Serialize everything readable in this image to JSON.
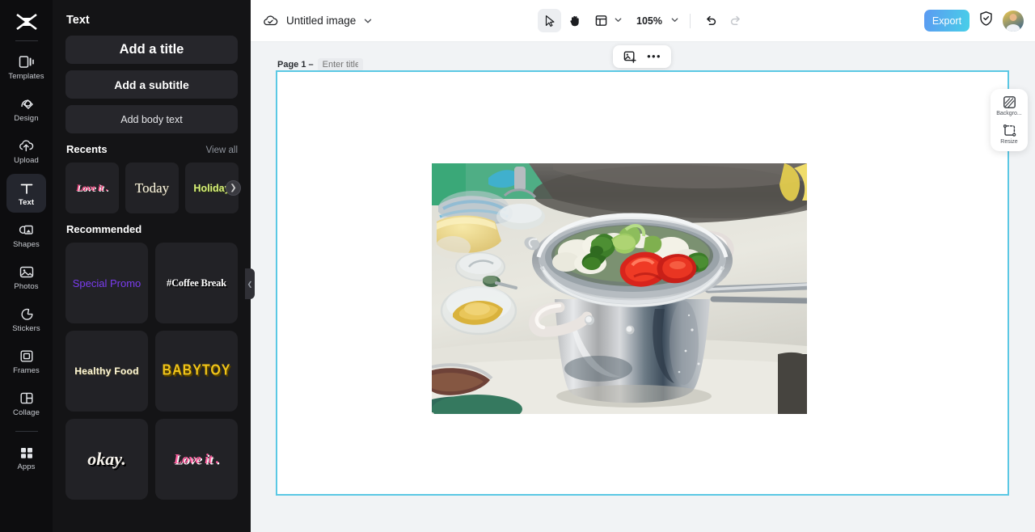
{
  "rail": {
    "logo_icon": "capcut-logo-icon",
    "items": [
      {
        "label": "Templates",
        "icon": "templates-icon",
        "active": false
      },
      {
        "label": "Design",
        "icon": "design-icon",
        "active": false
      },
      {
        "label": "Upload",
        "icon": "upload-cloud-icon",
        "active": false
      },
      {
        "label": "Text",
        "icon": "text-icon",
        "active": true
      },
      {
        "label": "Shapes",
        "icon": "shapes-icon",
        "active": false
      },
      {
        "label": "Photos",
        "icon": "photos-icon",
        "active": false
      },
      {
        "label": "Stickers",
        "icon": "stickers-icon",
        "active": false
      },
      {
        "label": "Frames",
        "icon": "frames-icon",
        "active": false
      },
      {
        "label": "Collage",
        "icon": "collage-icon",
        "active": false
      },
      {
        "label": "Apps",
        "icon": "apps-grid-icon",
        "active": false
      }
    ]
  },
  "panel": {
    "title": "Text",
    "add_buttons": [
      {
        "label": "Add a title"
      },
      {
        "label": "Add a subtitle"
      },
      {
        "label": "Add body text"
      }
    ],
    "recents": {
      "title": "Recents",
      "view_all": "View all",
      "next_icon": "chevron-right-icon",
      "items": [
        {
          "label": "Love it ."
        },
        {
          "label": "Today"
        },
        {
          "label": "Holiday"
        }
      ]
    },
    "recommended": {
      "title": "Recommended",
      "items": [
        {
          "label": "Special Promo"
        },
        {
          "label": "#Coffee Break"
        },
        {
          "label": "Healthy Food"
        },
        {
          "label": "BABYTOY"
        },
        {
          "label": "okay."
        },
        {
          "label": "Love it ."
        }
      ]
    },
    "collapse_icon": "chevron-left-icon"
  },
  "topbar": {
    "cloud_icon": "cloud-saved-icon",
    "doc_title": "Untitled image",
    "title_chevron_icon": "chevron-down-icon",
    "tools": [
      {
        "name": "select",
        "icon": "cursor-arrow-icon",
        "selected": true
      },
      {
        "name": "hand",
        "icon": "hand-icon",
        "selected": false
      },
      {
        "name": "layout",
        "icon": "layout-panel-icon",
        "selected": false
      }
    ],
    "layout_chevron_icon": "chevron-down-icon",
    "zoom": "105%",
    "zoom_chevron_icon": "chevron-down-icon",
    "undo_icon": "undo-icon",
    "redo_icon": "redo-icon",
    "export_label": "Export",
    "shield_icon": "shield-check-icon",
    "avatar_name": "user-avatar"
  },
  "stage": {
    "page_label": "Page 1 –",
    "page_title_value": "",
    "page_title_placeholder": "Enter title",
    "float_tools": [
      {
        "name": "add-image",
        "icon": "image-plus-icon"
      },
      {
        "name": "more",
        "icon": "more-dots-icon"
      }
    ],
    "canvas_border_color": "#5bc8e4",
    "photo_alt": "steamer pot with broccoli cauliflower and tomato on kitchen counter"
  },
  "right_panel": {
    "items": [
      {
        "label": "Backgro...",
        "icon": "background-pattern-icon"
      },
      {
        "label": "Resize",
        "icon": "resize-icon"
      }
    ]
  },
  "colors": {
    "rail_bg": "#0d0d0f",
    "panel_bg": "#141416",
    "accent_cyan": "#5bc8e4",
    "export_from": "#5b9af2",
    "export_to": "#48cfe8"
  }
}
